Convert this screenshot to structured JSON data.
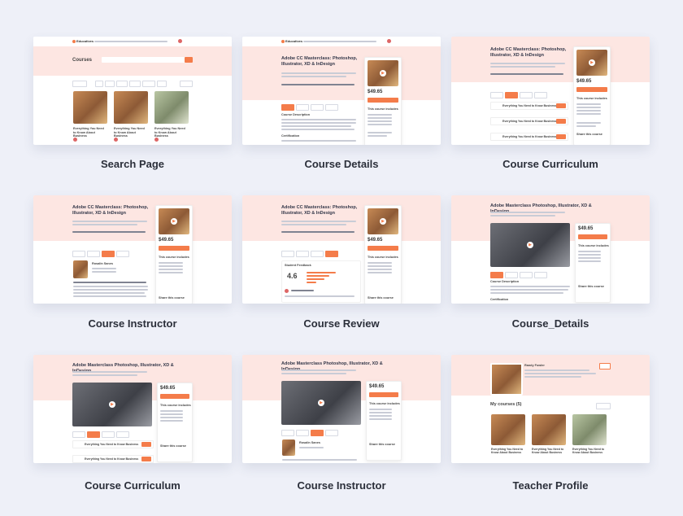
{
  "captions": [
    "Search Page",
    "Course Details",
    "Course Curriculum",
    "Course Instructor",
    "Course Review",
    "Course_Details",
    "Course Curriculum",
    "Course Instructor",
    "Teacher Profile"
  ],
  "brand": {
    "name": "Educatives"
  },
  "search_page": {
    "title": "Courses",
    "card_titles": [
      "Everything You Need to Know About Business",
      "Everything You Need to Know About Business",
      "Everything You Need to Know About Business"
    ]
  },
  "course": {
    "title_full": "Adobe CC Masterclass: Photoshop, Illustrator, XD & InDesign",
    "title_wide": "Adobe Masterclass Photoshop, Illustrator, XD & InDesign",
    "price": "$49.65",
    "includes": "This course includes",
    "tabs": [
      "Overview",
      "Curriculum",
      "Instructor",
      "Reviews"
    ],
    "section_description": "Course Description",
    "section_certification": "Certification",
    "lesson": "Everything You Need to Know Business",
    "share": "Share this course"
  },
  "instructor": {
    "name": "Rosalin Sanes"
  },
  "review": {
    "heading": "Student Feedback",
    "rating": "4.6"
  },
  "teacher": {
    "name": "Randy Fowler",
    "my_courses": "My courses (5)"
  },
  "colors": {
    "accent": "#f47c4a",
    "hero": "#fde6e2",
    "background": "#eef0f8"
  }
}
